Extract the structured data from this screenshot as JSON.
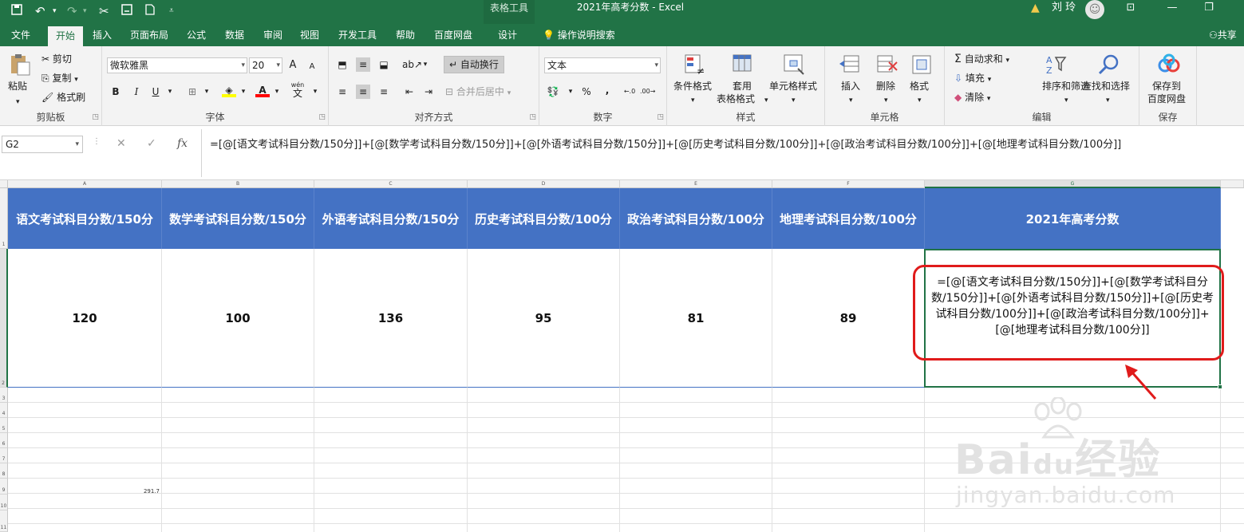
{
  "titlebar": {
    "context_tab": "表格工具",
    "title": "2021年高考分数 - Excel",
    "user": "刘 玲",
    "warning_icon": "warning-icon"
  },
  "tabs": [
    "文件",
    "开始",
    "插入",
    "页面布局",
    "公式",
    "数据",
    "审阅",
    "视图",
    "开发工具",
    "帮助",
    "百度网盘",
    "设计"
  ],
  "active_tab": "开始",
  "search_label": "操作说明搜索",
  "share_label": "共享",
  "ribbon": {
    "clipboard": {
      "paste": "粘贴",
      "cut": "剪切",
      "copy": "复制",
      "format_painter": "格式刷",
      "label": "剪贴板"
    },
    "font": {
      "name": "微软雅黑",
      "size": "20",
      "label": "字体",
      "bold": "B",
      "italic": "I",
      "underline": "U",
      "grow": "A",
      "shrink": "A",
      "wen": "wén",
      "wen_char": "文"
    },
    "alignment": {
      "wrap": "自动换行",
      "merge": "合并后居中",
      "label": "对齐方式"
    },
    "number": {
      "format": "文本",
      "percent": "%",
      "comma": ",",
      "label": "数字"
    },
    "styles": {
      "conditional": "条件格式",
      "table1": "套用",
      "table2": "表格格式",
      "cell_styles": "单元格样式",
      "label": "样式"
    },
    "cells": {
      "insert": "插入",
      "delete": "删除",
      "format": "格式",
      "label": "单元格"
    },
    "editing": {
      "autosum": "自动求和",
      "fill": "填充",
      "clear": "清除",
      "sort": "排序和筛选",
      "find": "查找和选择",
      "label": "编辑"
    },
    "save": {
      "line1": "保存到",
      "line2": "百度网盘",
      "label": "保存"
    }
  },
  "formula_bar": {
    "name_box": "G2",
    "formula": "=[@[语文考试科目分数/150分]]+[@[数学考试科目分数/150分]]+[@[外语考试科目分数/150分]]+[@[历史考试科目分数/100分]]+[@[政治考试科目分数/100分]]+[@[地理考试科目分数/100分]]"
  },
  "columns": [
    "A",
    "B",
    "C",
    "D",
    "E",
    "F",
    "G"
  ],
  "rows": [
    "1",
    "2",
    "3",
    "4",
    "5",
    "6",
    "7",
    "8",
    "9",
    "10",
    "11"
  ],
  "table": {
    "headers": [
      "语文考试科目分数/150分",
      "数学考试科目分数/150分",
      "外语考试科目分数/150分",
      "历史考试科目分数/100分",
      "政治考试科目分数/100分",
      "地理考试科目分数/100分",
      "2021年高考分数"
    ],
    "values": [
      "120",
      "100",
      "136",
      "95",
      "81",
      "89"
    ],
    "g2_text": "=[@[语文考试科目分数/150分]]+[@[数学考试科目分数/150分]]+[@[外语考试科目分数/150分]]+[@[历史考试科目分数/100分]]+[@[政治考试科目分数/100分]]+[@[地理考试科目分数/100分]]"
  },
  "b9_value": "291.7",
  "watermark": {
    "line1": "Bai",
    "line1b": "du",
    "line1c": "经验",
    "line2": "jingyan.baidu.com"
  },
  "colors": {
    "excel_green": "#217346",
    "table_header": "#4472c4",
    "highlight_red": "#e01b1b"
  }
}
